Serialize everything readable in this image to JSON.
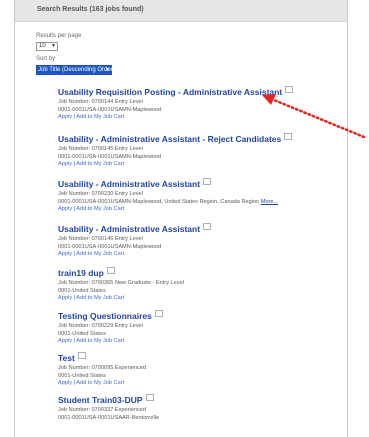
{
  "header": {
    "results_text": "Search Results (163 jobs found)"
  },
  "controls": {
    "results_per_page_label": "Results per page",
    "results_per_page_value": "10",
    "sort_by_label": "Sort by",
    "sort_by_value": "Job Title (Descending Order)"
  },
  "jobs": [
    {
      "title": "Usability Requisition Posting - Administrative Assistant",
      "line1": "Job Number: 0700144 Entry Level",
      "line2": "0001-0001USA-0001USAMN-Maplewood",
      "more": "",
      "apply": "Apply",
      "add": "Add to My Job Cart"
    },
    {
      "title": "Usability - Administrative Assistant - Reject Candidates",
      "line1": "Job Number: 0700145 Entry Level",
      "line2": "0001-0001USA-0001USAMN-Maplewood",
      "more": "",
      "apply": "Apply",
      "add": "Add to My Job Cart"
    },
    {
      "title": "Usability - Administrative Assistant",
      "line1": "Job Number: 0700230 Entry Level",
      "line2": "0001-0001USA-0001USAMN-Maplewood, United States Region, Canada Region",
      "more": "More...",
      "apply": "Apply",
      "add": "Add to My Job Cart"
    },
    {
      "title": "Usability - Administrative Assistant",
      "line1": "Job Number: 0700146 Entry Level",
      "line2": "0001-0001USA-0001USAMN-Maplewood",
      "more": "",
      "apply": "Apply",
      "add": "Add to My Job Cart"
    },
    {
      "title": "train19 dup",
      "line1": "Job Number: 0700365 New Graduate - Entry Level",
      "line2": "0001-United States",
      "more": "",
      "apply": "Apply",
      "add": "Add to My Job Cart"
    },
    {
      "title": "Testing Questionnaires",
      "line1": "Job Number: 0700229 Entry Level",
      "line2": "0001-United States",
      "more": "",
      "apply": "Apply",
      "add": "Add to My Job Cart"
    },
    {
      "title": "Test",
      "line1": "Job Number: 0700095 Experienced",
      "line2": "0001-United States",
      "more": "",
      "apply": "Apply",
      "add": "Add to My Job Cart"
    },
    {
      "title": "Student Train03-DUP",
      "line1": "Job Number: 0700337 Experienced",
      "line2": "0001-0001USA-0001USAAR-Bentonville",
      "more": "",
      "apply": "",
      "add": ""
    }
  ],
  "colors": {
    "link": "#2244a0",
    "sort_highlight": "#1e55c0",
    "annotation": "#e8231f"
  }
}
